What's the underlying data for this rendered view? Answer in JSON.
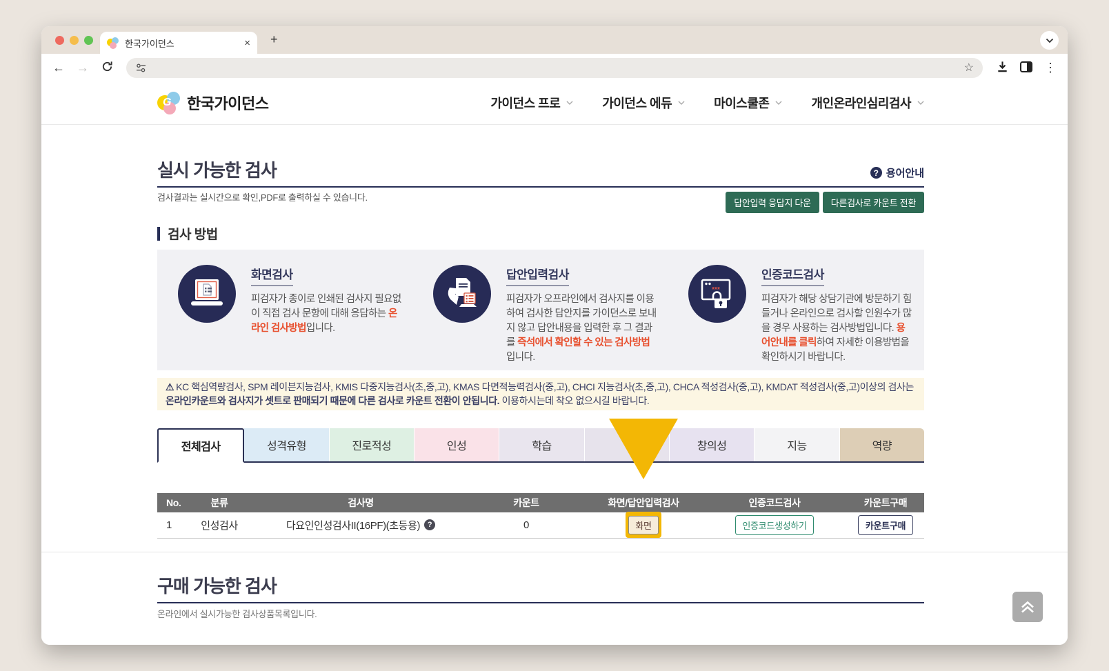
{
  "colors": {
    "annotation_yellow": "#f3b705",
    "brand_navy": "#272e56",
    "green_button": "#2e6b55",
    "red_accent": "#e8502e"
  },
  "browser": {
    "tab_title": "한국가이던스"
  },
  "header": {
    "logo_text": "한국가이던스",
    "nav_items": [
      {
        "label": "가이던스 프로"
      },
      {
        "label": "가이던스 에듀"
      },
      {
        "label": "마이스쿨존"
      },
      {
        "label": "개인온라인심리검사"
      }
    ]
  },
  "available_tests": {
    "title": "실시 가능한 검사",
    "help_link": "용어안내",
    "subtitle": "검사결과는 실시간으로 확인,PDF로 출력하실 수 있습니다.",
    "action_buttons": [
      {
        "label": "답안입력 응답지 다운"
      },
      {
        "label": "다른검사로 카운트 전환"
      }
    ]
  },
  "methods": {
    "heading": "검사 방법",
    "cards": [
      {
        "title": "화면검사",
        "body_pre": "피검자가 종이로 인쇄된 검사지 필요없이 직접 검사 문항에 대해 응답하는 ",
        "body_red": "온라인 검사방법",
        "body_post": "입니다."
      },
      {
        "title": "답안입력검사",
        "body_pre": "피검자가 오프라인에서 검사지를 이용하여 검사한 답안지를 가이던스로 보내지 않고 답안내용을 입력한 후 그 결과를 ",
        "body_red": "즉석에서 확인할 수 있는 검사방법",
        "body_post": "입니다."
      },
      {
        "title": "인증코드검사",
        "body_pre": "피검자가 해당 상담기관에 방문하기 힘들거나 온라인으로 검사할 인원수가 많을 경우 사용하는 검사방법입니다. ",
        "body_red": "용어안내를 클릭",
        "body_post": "하여 자세한 이용방법을 확인하시기 바랍니다."
      }
    ]
  },
  "notice": {
    "normal_1": "KC 핵심역량검사, SPM 레이븐지능검사, KMIS 다중지능검사(초,중,고), KMAS 다면적능력검사(중,고), CHCI 지능검사(초,중,고), CHCA 적성검사(중,고), KMDAT 적성검사(중,고)이상의 검사는 ",
    "bold": "온라인카운트와 검사지가 셋트로 판매되기 때문에 다른 검사로 카운트 전환이 안됩니다.",
    "normal_2": " 이용하시는데 착오 없으시길 바랍니다."
  },
  "tabs": [
    {
      "label": "전체검사",
      "color": "#ffffff",
      "active": true
    },
    {
      "label": "성격유형",
      "color": "#dcebf6"
    },
    {
      "label": "진로적성",
      "color": "#def0e3"
    },
    {
      "label": "인성",
      "color": "#fae2e8"
    },
    {
      "label": "학습",
      "color": "#e9e5ee"
    },
    {
      "label": "",
      "color": "#e7e3ec"
    },
    {
      "label": "창의성",
      "color": "#e7e2f0"
    },
    {
      "label": "지능",
      "color": "#f3f3f5"
    },
    {
      "label": "역량",
      "color": "#ddceb6"
    }
  ],
  "table": {
    "headers": [
      "No.",
      "분류",
      "검사명",
      "카운트",
      "화면/답안입력검사",
      "인증코드검사",
      "카운트구매"
    ],
    "row": {
      "no": "1",
      "category": "인성검사",
      "name": "다요인인성검사II(16PF)(초등용)",
      "count": "0",
      "screen_button": "화면",
      "authcode_button": "인증코드생성하기",
      "purchase_button": "카운트구매"
    }
  },
  "purchasable_tests": {
    "title": "구매 가능한 검사",
    "subtitle": "온라인에서 실시가능한 검사상품목록입니다."
  }
}
